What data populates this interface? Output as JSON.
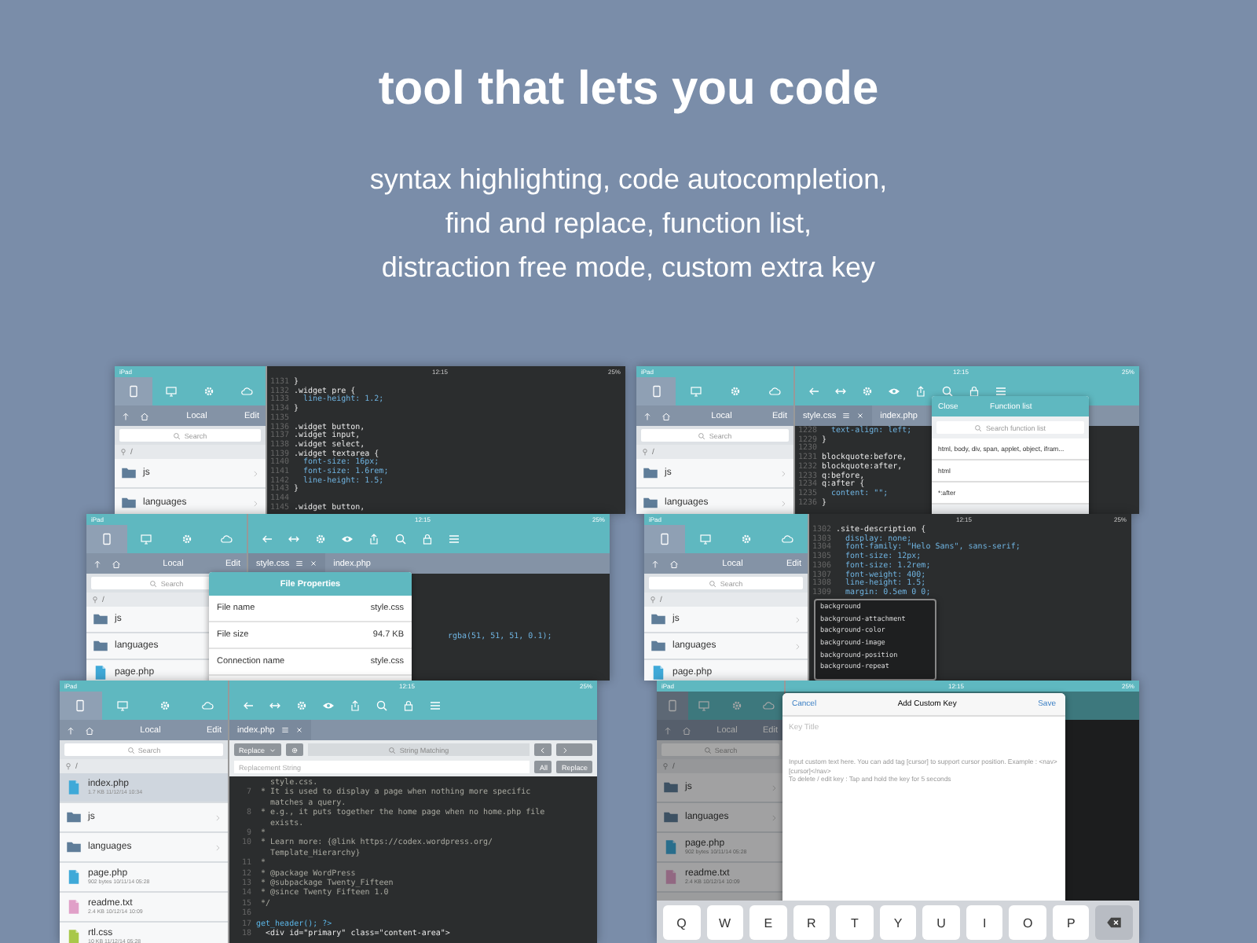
{
  "header": {
    "title": "tool that lets you code",
    "subtitle": [
      "syntax highlighting, code autocompletion,",
      "find and replace, function list,",
      "distraction free mode, custom extra key"
    ]
  },
  "screens": [
    {
      "status": {
        "carrier": "iPad",
        "time": "12:15",
        "battery": "25%"
      },
      "sidebar": {
        "tabs": [
          {
            "selected": true
          },
          {
            "selected": false
          },
          {
            "selected": false
          },
          {
            "selected": false
          }
        ],
        "location": "Local",
        "edit": "Edit",
        "search": "Search",
        "path": "/",
        "files": [
          {
            "name": "js",
            "kind": "folder",
            "selected": false
          },
          {
            "name": "languages",
            "kind": "folder",
            "selected": false
          }
        ]
      },
      "editor": {
        "toolbar": false,
        "code": [
          {
            "n": "1131",
            "t": "}",
            "kind": "sel"
          },
          {
            "n": "1132",
            "t": ".widget pre {",
            "kind": "sel"
          },
          {
            "n": "1133",
            "t": "  line-height: 1.2;",
            "kind": "prop"
          },
          {
            "n": "1134",
            "t": "}",
            "kind": "sel"
          },
          {
            "n": "1135"
          },
          {
            "n": "1136",
            "t": ".widget button,",
            "kind": "sel"
          },
          {
            "n": "1137",
            "t": ".widget input,",
            "kind": "sel"
          },
          {
            "n": "1138",
            "t": ".widget select,",
            "kind": "sel"
          },
          {
            "n": "1139",
            "t": ".widget textarea {",
            "kind": "sel"
          },
          {
            "n": "1140",
            "t": "  font-size: 16px;",
            "kind": "prop"
          },
          {
            "n": "1141",
            "t": "  font-size: 1.6rem;",
            "kind": "prop"
          },
          {
            "n": "1142",
            "t": "  line-height: 1.5;",
            "kind": "prop"
          },
          {
            "n": "1143",
            "t": "}",
            "kind": "sel"
          },
          {
            "n": "1144"
          },
          {
            "n": "1145",
            "t": ".widget button,",
            "kind": "sel"
          }
        ]
      }
    },
    {
      "status": {
        "carrier": "iPad",
        "time": "12:15",
        "battery": "25%"
      },
      "sidebar": {
        "tabs": [
          {
            "selected": true
          },
          {
            "selected": false
          },
          {
            "selected": false
          },
          {
            "selected": false
          }
        ],
        "location": "Local",
        "edit": "Edit",
        "search": "Search",
        "path": "/",
        "files": [
          {
            "name": "js",
            "kind": "folder",
            "selected": false
          },
          {
            "name": "languages",
            "kind": "folder",
            "selected": false
          },
          {
            "name": "page.php",
            "kind": "php",
            "selected": false
          }
        ]
      },
      "editor": {
        "toolbar": true,
        "tabs": [
          {
            "label": "style.css",
            "selected": true
          },
          {
            "label": "index.php",
            "selected": false
          }
        ],
        "code": [
          {
            "t": "rgba(51, 51, 51, 0.1);",
            "kind": "prop"
          }
        ]
      },
      "overlay": {
        "kind": "properties",
        "title": "File Properties",
        "rows": [
          {
            "label": "File name",
            "value": "style.css"
          },
          {
            "label": "File size",
            "value": "94.7 KB"
          },
          {
            "label": "Connection name",
            "value": "style.css"
          }
        ]
      }
    },
    {
      "status": {
        "carrier": "iPad",
        "time": "12:15",
        "battery": "25%"
      },
      "sidebar": {
        "tabs": [
          {
            "selected": true
          },
          {
            "selected": false
          },
          {
            "selected": false
          },
          {
            "selected": false
          }
        ],
        "location": "Local",
        "edit": "Edit",
        "search": "Search",
        "path": "/",
        "files": [
          {
            "name": "index.php",
            "info": "1.7 KB 11/12/14 10:34",
            "kind": "php",
            "selected": true
          },
          {
            "name": "js",
            "kind": "folder",
            "selected": false
          },
          {
            "name": "languages",
            "kind": "folder",
            "selected": false
          },
          {
            "name": "page.php",
            "info": "902 bytes 10/11/14 05:28",
            "kind": "php",
            "selected": false
          },
          {
            "name": "readme.txt",
            "info": "2.4 KB 10/12/14 10:09",
            "kind": "txt",
            "selected": false
          },
          {
            "name": "rtl.css",
            "info": "10 KB 11/12/14 05:28",
            "kind": "css",
            "selected": false
          }
        ]
      },
      "editor": {
        "toolbar": true,
        "tabs": [
          {
            "label": "index.php",
            "selected": true
          }
        ],
        "find": {
          "mode": "Replace",
          "search_placeholder": "String Matching",
          "replace_placeholder": "Replacement String",
          "all": "All",
          "replace": "Replace"
        },
        "code": [
          {
            "t": "   style.css.",
            "kind": "com"
          },
          {
            "n": "7",
            "t": " * It is used to display a page when nothing more specific",
            "kind": "com"
          },
          {
            "t": "   matches a query.",
            "kind": "com"
          },
          {
            "n": "8",
            "t": " * e.g., it puts together the home page when no home.php file",
            "kind": "com"
          },
          {
            "t": "   exists.",
            "kind": "com"
          },
          {
            "n": "9",
            "t": " *",
            "kind": "com"
          },
          {
            "n": "10",
            "t": " * Learn more: {@link https://codex.wordpress.org/",
            "kind": "com"
          },
          {
            "t": "   Template_Hierarchy}",
            "kind": "com"
          },
          {
            "n": "11",
            "t": " *",
            "kind": "com"
          },
          {
            "n": "12",
            "t": " * @package WordPress",
            "kind": "com"
          },
          {
            "n": "13",
            "t": " * @subpackage Twenty_Fifteen",
            "kind": "com"
          },
          {
            "n": "14",
            "t": " * @since Twenty Fifteen 1.0",
            "kind": "com"
          },
          {
            "n": "15",
            "t": " */",
            "kind": "com"
          },
          {
            "n": "16"
          },
          {
            "n": "17",
            "t": "get_header(); ?>",
            "kind": "php"
          },
          {
            "n": "18",
            "t": "  <div id=\"primary\" class=\"content-area\">",
            "kind": "sel"
          }
        ]
      }
    },
    {
      "status": {
        "carrier": "iPad",
        "time": "12:15",
        "battery": "25%"
      },
      "sidebar": {
        "tabs": [
          {
            "selected": true
          },
          {
            "selected": false
          },
          {
            "selected": false
          },
          {
            "selected": false
          }
        ],
        "location": "Local",
        "edit": "Edit",
        "search": "Search",
        "path": "/",
        "files": [
          {
            "name": "js",
            "kind": "folder",
            "selected": false
          },
          {
            "name": "languages",
            "kind": "folder",
            "selected": false
          }
        ]
      },
      "editor": {
        "toolbar": true,
        "tabs": [
          {
            "label": "style.css",
            "selected": true
          },
          {
            "label": "index.php",
            "selected": false
          }
        ],
        "code": [
          {
            "n": "1228",
            "t": "  text-align: left;",
            "kind": "prop"
          },
          {
            "n": "1229",
            "t": "}",
            "kind": "sel"
          },
          {
            "n": "1230"
          },
          {
            "n": "1231",
            "t": "blockquote:before,",
            "kind": "sel"
          },
          {
            "n": "1232",
            "t": "blockquote:after,",
            "kind": "sel"
          },
          {
            "n": "1233",
            "t": "q:before,",
            "kind": "sel"
          },
          {
            "n": "1234",
            "t": "q:after {",
            "kind": "sel"
          },
          {
            "n": "1235",
            "t": "  content: \"\";",
            "kind": "prop"
          },
          {
            "n": "1236",
            "t": "}",
            "kind": "sel"
          }
        ]
      },
      "overlay": {
        "kind": "functions",
        "close": "Close",
        "title": "Function list",
        "search": "Search function list",
        "items": [
          "html, body, div, span, applet, object, ifram...",
          "html",
          "*:after"
        ]
      }
    },
    {
      "status": {
        "carrier": "iPad",
        "time": "12:15",
        "battery": "25%"
      },
      "sidebar": {
        "tabs": [
          {
            "selected": true
          },
          {
            "selected": false
          },
          {
            "selected": false
          },
          {
            "selected": false
          }
        ],
        "location": "Local",
        "edit": "Edit",
        "search": "Search",
        "path": "/",
        "files": [
          {
            "name": "js",
            "kind": "folder",
            "selected": false
          },
          {
            "name": "languages",
            "kind": "folder",
            "selected": false
          },
          {
            "name": "page.php",
            "kind": "php",
            "selected": false
          }
        ]
      },
      "editor": {
        "toolbar": false,
        "code": [
          {
            "n": "1302",
            "t": ".site-description {",
            "kind": "sel"
          },
          {
            "n": "1303",
            "t": "  display: none;",
            "kind": "prop"
          },
          {
            "n": "1304",
            "t": "  font-family: \"Helo Sans\", sans-serif;",
            "kind": "prop"
          },
          {
            "n": "1305",
            "t": "  font-size: 12px;",
            "kind": "prop"
          },
          {
            "n": "1306",
            "t": "  font-size: 1.2rem;",
            "kind": "prop"
          },
          {
            "n": "1307",
            "t": "  font-weight: 400;",
            "kind": "prop"
          },
          {
            "n": "1308",
            "t": "  line-height: 1.5;",
            "kind": "prop"
          },
          {
            "n": "1309",
            "t": "  margin: 0.5em 0 0;",
            "kind": "prop"
          }
        ]
      },
      "overlay": {
        "kind": "autocomplete",
        "items": [
          "background",
          "background-attachment",
          "background-color",
          "background-image",
          "background-position",
          "background-repeat"
        ]
      }
    },
    {
      "status": {
        "carrier": "iPad",
        "time": "12:15",
        "battery": "25%"
      },
      "dimmed": true,
      "sidebar": {
        "tabs": [
          {
            "selected": true
          },
          {
            "selected": false
          },
          {
            "selected": false
          },
          {
            "selected": false
          }
        ],
        "location": "Local",
        "edit": "Edit",
        "search": "Search",
        "path": "/",
        "files": [
          {
            "name": "js",
            "kind": "folder",
            "selected": false
          },
          {
            "name": "languages",
            "kind": "folder",
            "selected": false
          },
          {
            "name": "page.php",
            "info": "902 bytes 10/11/14 05:28",
            "kind": "php",
            "selected": false
          },
          {
            "name": "readme.txt",
            "info": "2.4 KB 10/12/14 10:09",
            "kind": "txt",
            "selected": false
          }
        ]
      },
      "editor": {
        "toolbar": true
      },
      "overlay": {
        "kind": "custom_key",
        "cancel": "Cancel",
        "title": "Add Custom Key",
        "save": "Save",
        "placeholder": "Key Title",
        "help": [
          "Input custom text here. You can add tag [cursor] to support cursor position. Example : <nav>[cursor]</nav>",
          "To delete / edit key : Tap and hold the key for 5 seconds"
        ],
        "keys": [
          "Q",
          "W",
          "E",
          "R",
          "T",
          "Y",
          "U",
          "I",
          "O",
          "P"
        ]
      }
    }
  ]
}
